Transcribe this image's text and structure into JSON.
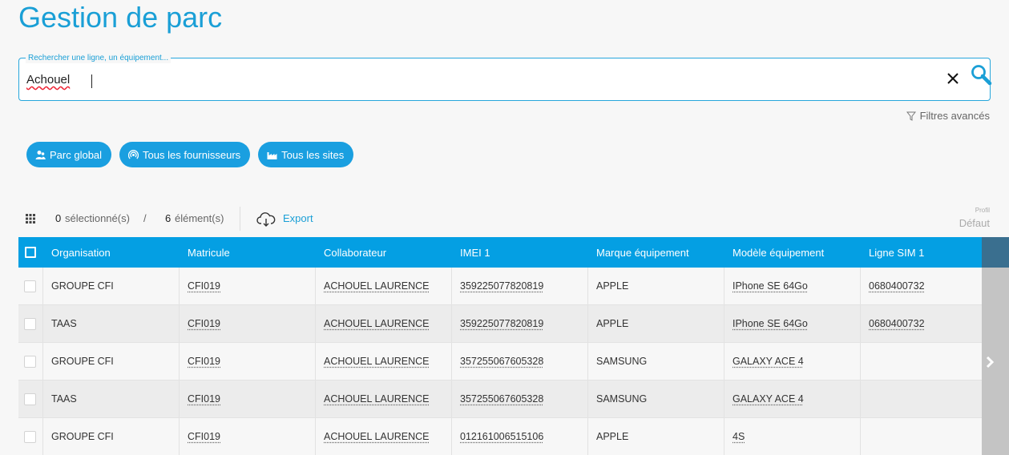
{
  "page": {
    "title": "Gestion de parc"
  },
  "search": {
    "legend": "Rechercher une ligne, un équipement...",
    "value": "Achouel"
  },
  "filters": {
    "label": "Filtres avancés"
  },
  "chips": [
    {
      "label": "Parc global",
      "icon": "users-icon"
    },
    {
      "label": "Tous les fournisseurs",
      "icon": "antenna-icon"
    },
    {
      "label": "Tous les sites",
      "icon": "factory-icon"
    }
  ],
  "toolbar": {
    "selected_count": "0",
    "selected_label": "sélectionné(s)",
    "separator": "/",
    "element_count": "6",
    "element_label": "élément(s)",
    "export_label": "Export",
    "profile_label": "Profil",
    "profile_value": "Défaut"
  },
  "table": {
    "columns": [
      "Organisation",
      "Matricule",
      "Collaborateur",
      "IMEI 1",
      "Marque équipement",
      "Modèle équipement",
      "Ligne SIM 1"
    ],
    "rows": [
      [
        "GROUPE CFI",
        "CFI019",
        "ACHOUEL LAURENCE",
        "359225077820819",
        "APPLE",
        "IPhone SE 64Go",
        "0680400732"
      ],
      [
        "TAAS",
        "CFI019",
        "ACHOUEL LAURENCE",
        "359225077820819",
        "APPLE",
        "IPhone SE 64Go",
        "0680400732"
      ],
      [
        "GROUPE CFI",
        "CFI019",
        "ACHOUEL LAURENCE",
        "357255067605328",
        "SAMSUNG",
        "GALAXY ACE 4",
        ""
      ],
      [
        "TAAS",
        "CFI019",
        "ACHOUEL LAURENCE",
        "357255067605328",
        "SAMSUNG",
        "GALAXY ACE 4",
        ""
      ],
      [
        "GROUPE CFI",
        "CFI019",
        "ACHOUEL LAURENCE",
        "012161006515106",
        "APPLE",
        "4S",
        ""
      ]
    ]
  },
  "colors": {
    "accent": "#1a9fd6",
    "header": "#049fe3",
    "chip": "#1a9fe0"
  }
}
